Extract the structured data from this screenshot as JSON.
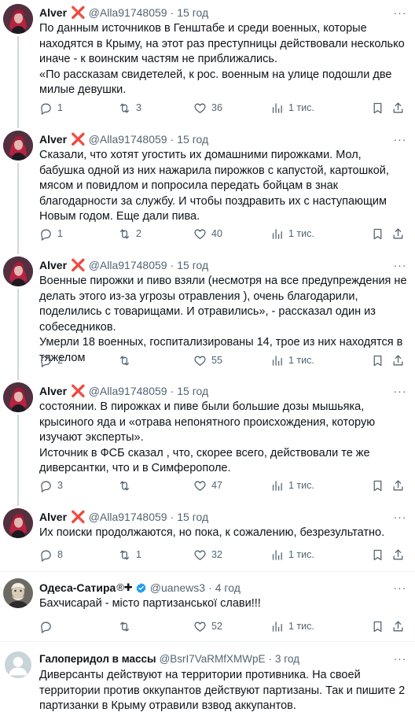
{
  "tweets": [
    {
      "name": "Alver",
      "handle": "@Alla91748059",
      "dot": "·",
      "time": "15 год",
      "text": "По данным источников в Генштабе и среди военных, которые находятся в Крыму, на этот раз преступницы действовали несколько иначе - к воинским частям не приближались.\n«По рассказам свидетелей, к рос. военным на улице подошли две милые девушки.",
      "replies": "1",
      "retweets": "3",
      "likes": "36",
      "views": "1 тис."
    },
    {
      "name": "Alver",
      "handle": "@Alla91748059",
      "dot": "·",
      "time": "15 год",
      "text": "Сказали, что хотят угостить их домашними пирожками. Мол, бабушка одной из них нажарила пирожков с капустой, картошкой, мясом и повидлом и попросила передать бойцам в знак благодарности за службу. И чтобы поздравить их с наступающим Новым годом. Еще дали пива.",
      "replies": "1",
      "retweets": "2",
      "likes": "40",
      "views": "1 тис."
    },
    {
      "name": "Alver",
      "handle": "@Alla91748059",
      "dot": "·",
      "time": "15 год",
      "text": "Военные пирожки и пиво взяли (несмотря на все предупреждения  не делать этого из-за угрозы отравления ), очень благодарили, поделились с товарищами. И отравились», - рассказал один из  собеседников.\nУмерли 18 военных, госпитализированы 14, трое из них находятся в тяжелом",
      "replies": "2",
      "retweets": "",
      "likes": "55",
      "views": "1 тис."
    },
    {
      "name": "Alver",
      "handle": "@Alla91748059",
      "dot": "·",
      "time": "15 год",
      "text": "состоянии. В пирожках и пиве были большие дозы мышьяка, крысиного яда и «отрава непонятного происхождения, которую изучают эксперты».\nИсточник в ФСБ сказал , что, скорее всего, действовали те же диверсантки, что и в Симферополе.",
      "replies": "3",
      "retweets": "",
      "likes": "47",
      "views": "1 тис."
    },
    {
      "name": "Alver",
      "handle": "@Alla91748059",
      "dot": "·",
      "time": "15 год",
      "text": "Их поиски продолжаются, но пока, к сожалению, безрезультатно.",
      "replies": "8",
      "retweets": "1",
      "likes": "32",
      "views": "1 тис."
    },
    {
      "name": "Одеса-Сатира",
      "handle": "@uanews3",
      "dot": "·",
      "time": "4 год",
      "text": "Бахчисарай - місто партизанської слави!!!",
      "replies": "",
      "retweets": "",
      "likes": "52",
      "views": "1 тис."
    },
    {
      "name": "Галоперидол в массы",
      "handle": "@BsrI7VaRMfXMWpE",
      "dot": "·",
      "time": "3 год",
      "text": "Диверсанты действуют на территории противника. На своей территории против оккупантов действуют партизаны. Так и пишите 2 партизанки в Крыму отравили взвод аккупантов.",
      "replies": "",
      "retweets": "",
      "likes": "",
      "views": ""
    }
  ],
  "icons": {
    "flag_x": "❌",
    "odesa_badges": "®✚",
    "more": "···"
  },
  "colors": {
    "text": "#0f1419",
    "secondary": "#536471",
    "x_mark": "#e0245e",
    "verified": "#1d9bf0",
    "thread_line": "#cfd9de",
    "separator": "#eff3f4"
  }
}
